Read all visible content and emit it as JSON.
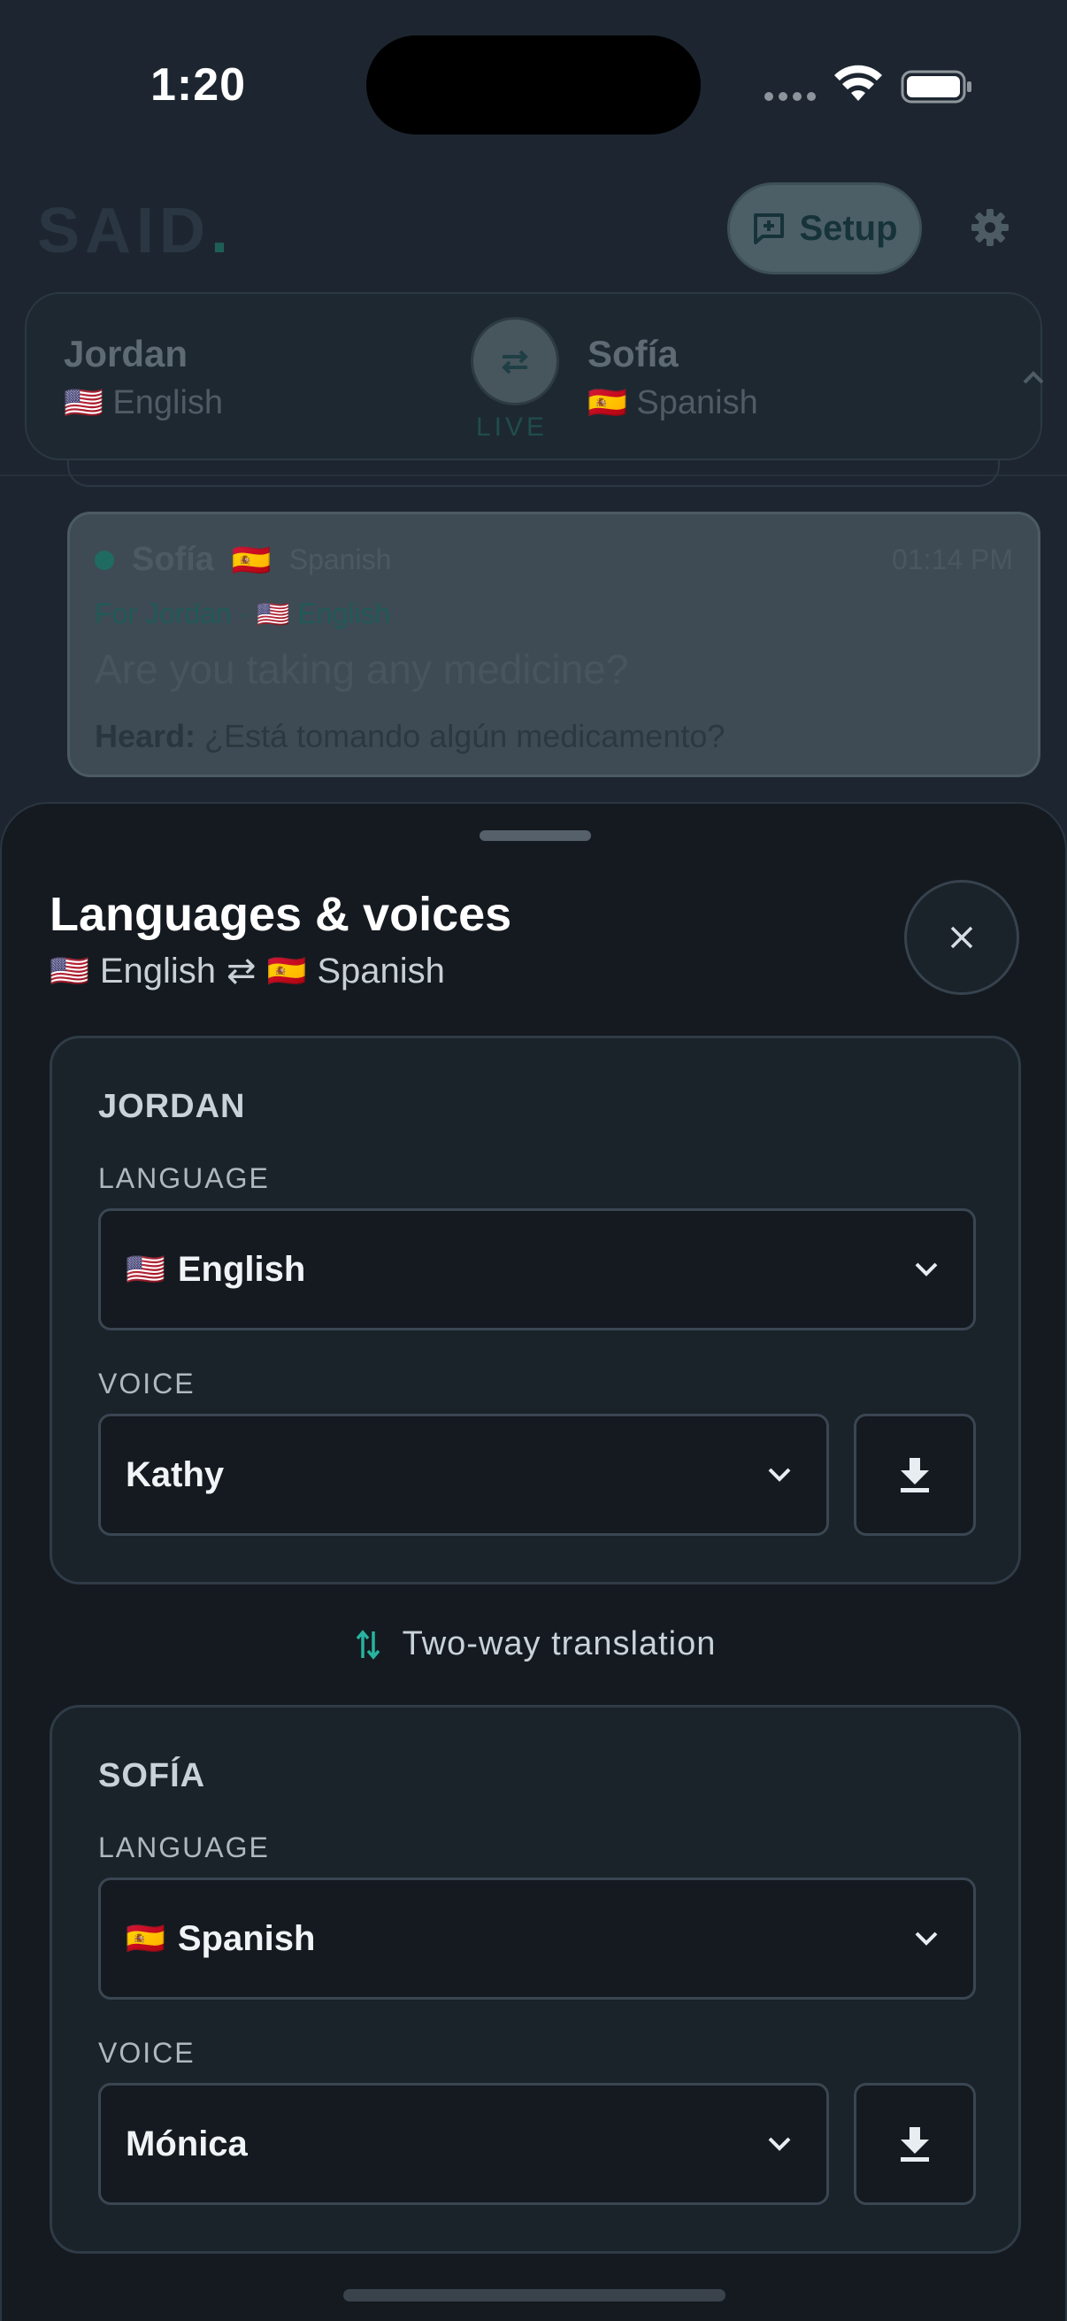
{
  "status_bar": {
    "time": "1:20"
  },
  "app": {
    "logo": "SAID",
    "logo_dot": ".",
    "setup_label": "Setup",
    "speaker_a": {
      "name": "Jordan",
      "flag": "🇺🇸",
      "language": "English"
    },
    "speaker_b": {
      "name": "Sofía",
      "flag": "🇪🇸",
      "language": "Spanish"
    },
    "live_label": "LIVE",
    "message": {
      "speaker": "Sofía",
      "flag": "🇪🇸",
      "language": "Spanish",
      "time": "01:14 PM",
      "for_label": "For Jordan ·",
      "for_flag": "🇺🇸",
      "for_language": "English",
      "text": "Are you taking any medicine?",
      "heard_label": "Heard:",
      "heard_text": "¿Está tomando algún medicamento?"
    }
  },
  "sheet": {
    "title": "Languages & voices",
    "subtitle_flag_a": "🇺🇸",
    "subtitle_lang_a": "English",
    "subtitle_arrows": "⇄",
    "subtitle_flag_b": "🇪🇸",
    "subtitle_lang_b": "Spanish",
    "panels": [
      {
        "name": "JORDAN",
        "language_label": "LANGUAGE",
        "language_flag": "🇺🇸",
        "language_value": "English",
        "voice_label": "VOICE",
        "voice_value": "Kathy"
      },
      {
        "name": "SOFÍA",
        "language_label": "LANGUAGE",
        "language_flag": "🇪🇸",
        "language_value": "Spanish",
        "voice_label": "VOICE",
        "voice_value": "Mónica"
      }
    ],
    "two_way_label": "Two-way translation",
    "accent_color": "#27b3a0"
  }
}
